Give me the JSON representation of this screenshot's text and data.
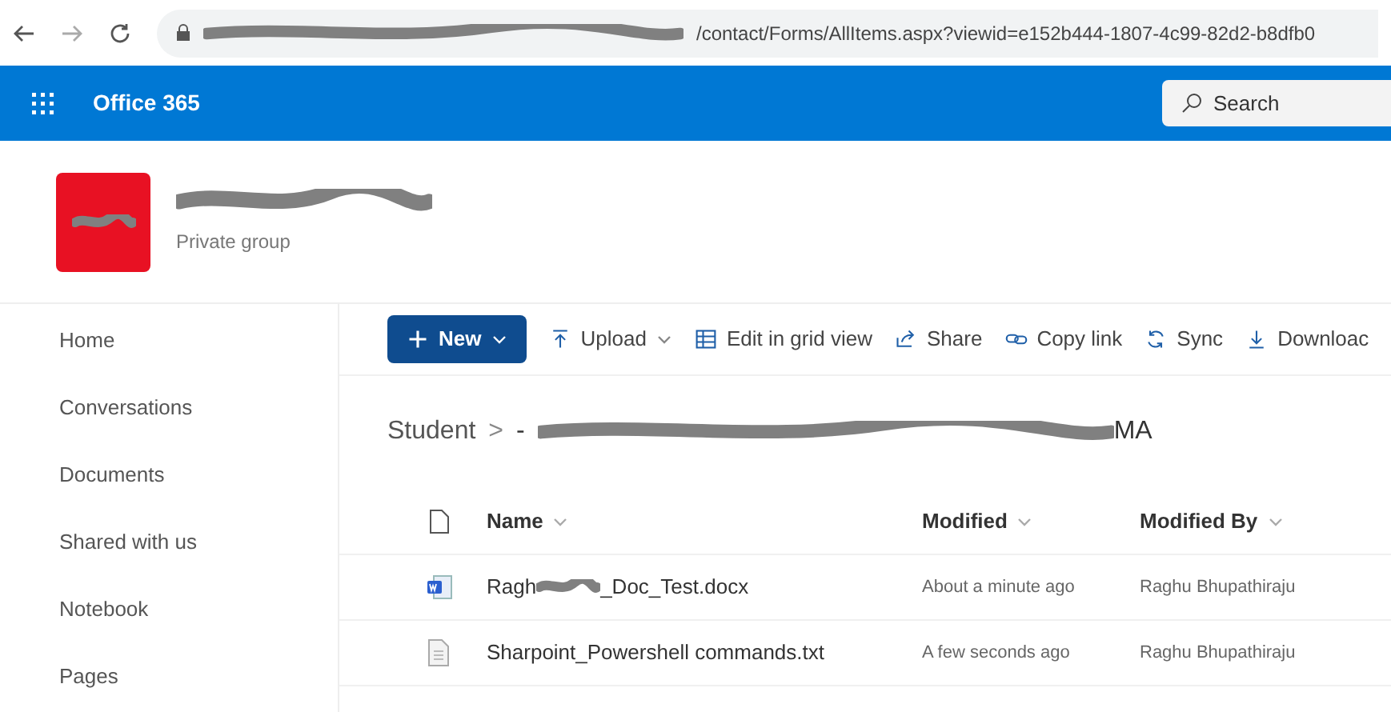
{
  "browser": {
    "url_visible": "/contact/Forms/AllItems.aspx?viewid=e152b444-1807-4c99-82d2-b8dfb0"
  },
  "suite_bar": {
    "title": "Office 365",
    "search": {
      "placeholder": "Search"
    }
  },
  "group": {
    "subtitle": "Private group"
  },
  "sidebar": {
    "items": [
      {
        "label": "Home"
      },
      {
        "label": "Conversations"
      },
      {
        "label": "Documents"
      },
      {
        "label": "Shared with us"
      },
      {
        "label": "Notebook"
      },
      {
        "label": "Pages"
      }
    ]
  },
  "toolbar": {
    "items": [
      {
        "kind": "primary",
        "label": "New",
        "dropdown": true
      },
      {
        "kind": "command",
        "label": "Upload",
        "dropdown": true
      },
      {
        "kind": "command",
        "label": "Edit in grid view",
        "dropdown": false
      },
      {
        "kind": "command",
        "label": "Share",
        "dropdown": false
      },
      {
        "kind": "command",
        "label": "Copy link",
        "dropdown": false
      },
      {
        "kind": "command",
        "label": "Sync",
        "dropdown": false
      },
      {
        "kind": "command",
        "label": "Downloac",
        "dropdown": false
      }
    ]
  },
  "breadcrumb": {
    "root": "Student",
    "separator": ">",
    "current_start": "-",
    "current_end": "MA"
  },
  "table": {
    "columns": [
      "Name",
      "Modified",
      "Modified By"
    ],
    "rows": [
      {
        "kind": "word",
        "name_start": "Ragh",
        "name_end": "_Doc_Test.docx",
        "modified": "About a minute ago",
        "modified_by": "Raghu Bhupathiraju"
      },
      {
        "kind": "text",
        "name_start": "Sharpoint_Powershell commands.txt",
        "modified": "A few seconds ago",
        "modified_by": "Raghu Bhupathiraju"
      }
    ]
  }
}
